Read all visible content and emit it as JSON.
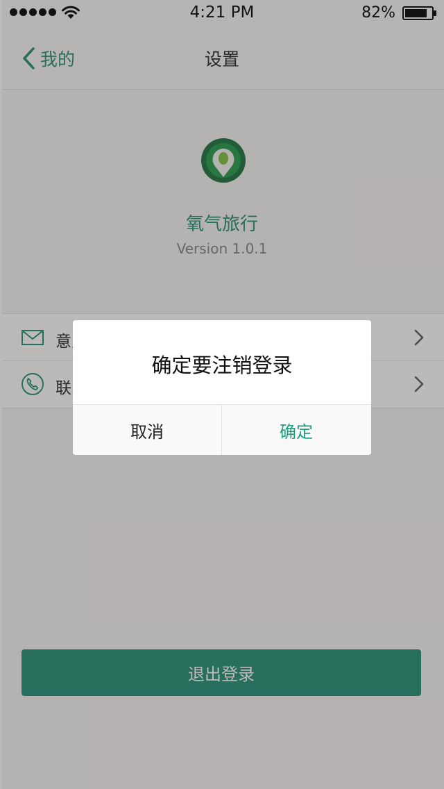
{
  "status_bar": {
    "time": "4:21 PM",
    "battery": "82%",
    "signal_icon": "signal-dots-icon",
    "wifi_icon": "wifi-icon",
    "battery_icon": "battery-icon"
  },
  "nav": {
    "back_label": "我的",
    "title": "设置"
  },
  "app": {
    "name": "氧气旅行",
    "version": "Version 1.0.1",
    "logo_icon": "location-pin-icon"
  },
  "settings": {
    "items": [
      {
        "label": "意见反馈",
        "icon": "mail-icon"
      },
      {
        "label": "联系我们",
        "icon": "phone-icon"
      }
    ]
  },
  "logout_button": "退出登录",
  "dialog": {
    "message": "确定要注销登录",
    "cancel": "取消",
    "confirm": "确定"
  },
  "colors": {
    "accent": "#1e8c74",
    "overlay": "rgba(60,52,50,0.34)"
  }
}
